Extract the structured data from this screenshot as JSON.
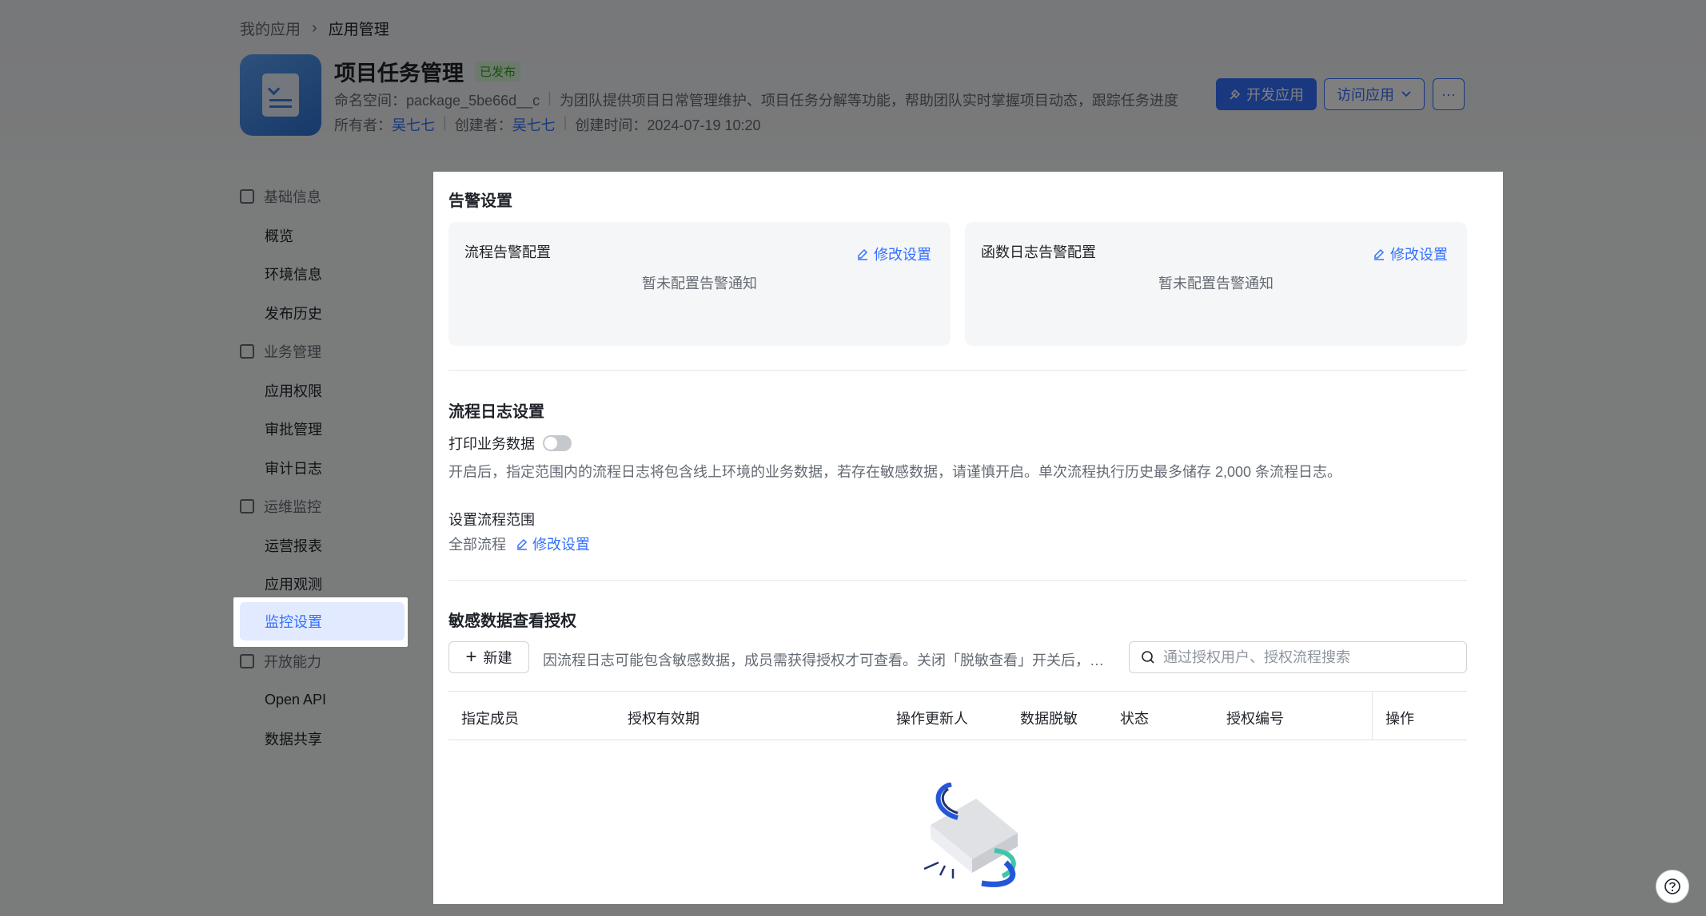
{
  "breadcrumb": {
    "parent": "我的应用",
    "current": "应用管理"
  },
  "app": {
    "title": "项目任务管理",
    "status_badge": "已发布",
    "namespace": "命名空间：package_5be66d__c",
    "description": "为团队提供项目日常管理维护、项目任务分解等功能，帮助团队实时掌握项目动态，跟踪任务进度",
    "owner_label": "所有者：",
    "owner": "吴七七",
    "creator_label": "创建者：",
    "creator": "吴七七",
    "created_label": "创建时间：",
    "created_at": "2024-07-19 10:20"
  },
  "actions": {
    "develop": "开发应用",
    "visit": "访问应用",
    "more": "···"
  },
  "sidebar": {
    "groups": [
      {
        "label": "基础信息",
        "items": [
          "概览",
          "环境信息",
          "发布历史"
        ]
      },
      {
        "label": "业务管理",
        "items": [
          "应用权限",
          "审批管理",
          "审计日志"
        ]
      },
      {
        "label": "运维监控",
        "items": [
          "运营报表",
          "应用观测",
          "监控设置"
        ]
      },
      {
        "label": "开放能力",
        "items": [
          "Open API",
          "数据共享"
        ]
      }
    ],
    "active": "监控设置"
  },
  "alert": {
    "title": "告警设置",
    "cards": [
      {
        "title": "流程告警配置",
        "link": "修改设置",
        "empty": "暂未配置告警通知"
      },
      {
        "title": "函数日志告警配置",
        "link": "修改设置",
        "empty": "暂未配置告警通知"
      }
    ]
  },
  "flow_log": {
    "title": "流程日志设置",
    "toggle_label": "打印业务数据",
    "toggle_on": false,
    "note": "开启后，指定范围内的流程日志将包含线上环境的业务数据，若存在敏感数据，请谨慎开启。单次流程执行历史最多储存 2,000 条流程日志。",
    "scope_label": "设置流程范围",
    "scope_value": "全部流程",
    "scope_link": "修改设置"
  },
  "sensitive": {
    "title": "敏感数据查看授权",
    "new_button": "新建",
    "hint": "因流程日志可能包含敏感数据，成员需获得授权才可查看。关闭「脱敏查看」开关后，指...",
    "search_placeholder": "通过授权用户、授权流程搜索",
    "columns": [
      "指定成员",
      "授权有效期",
      "操作更新人",
      "数据脱敏",
      "状态",
      "授权编号",
      "操作"
    ]
  },
  "colors": {
    "accent": "#3370ff",
    "success": "#2ea121",
    "overlay": "rgba(0,0,0,0.5)"
  }
}
